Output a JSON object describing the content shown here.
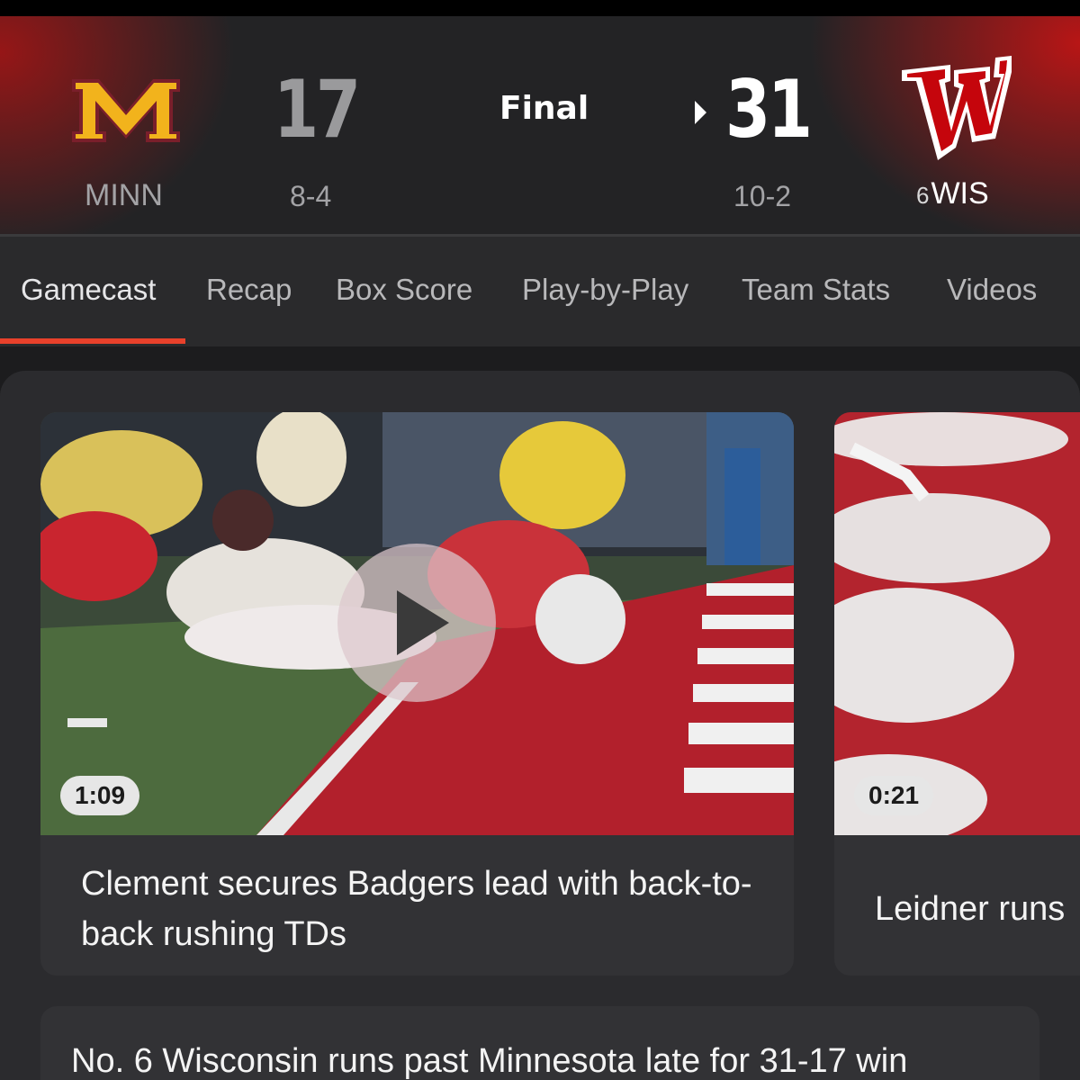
{
  "scoreboard": {
    "status": "Final",
    "away": {
      "abbr": "MINN",
      "score": "17",
      "record": "8-4",
      "logo": "minnesota-m-logo",
      "color": "#f2b31c"
    },
    "home": {
      "abbr": "WIS",
      "rank": "6",
      "score": "31",
      "record": "10-2",
      "logo": "wisconsin-w-logo",
      "color": "#c5050c",
      "has_possession_arrow": true
    }
  },
  "tabs": [
    {
      "label": "Gamecast",
      "active": true
    },
    {
      "label": "Recap"
    },
    {
      "label": "Box Score"
    },
    {
      "label": "Play-by-Play"
    },
    {
      "label": "Team Stats"
    },
    {
      "label": "Videos"
    }
  ],
  "videos": [
    {
      "duration": "1:09",
      "title": "Clement secures Badgers lead with back-to-back rushing TDs"
    },
    {
      "duration": "0:21",
      "title": "Leidner runs"
    }
  ],
  "story": {
    "title": "No. 6 Wisconsin runs past Minnesota late for 31-17 win"
  },
  "colors": {
    "accent": "#e8412b",
    "background": "#1c1c1e",
    "card": "#323235"
  }
}
